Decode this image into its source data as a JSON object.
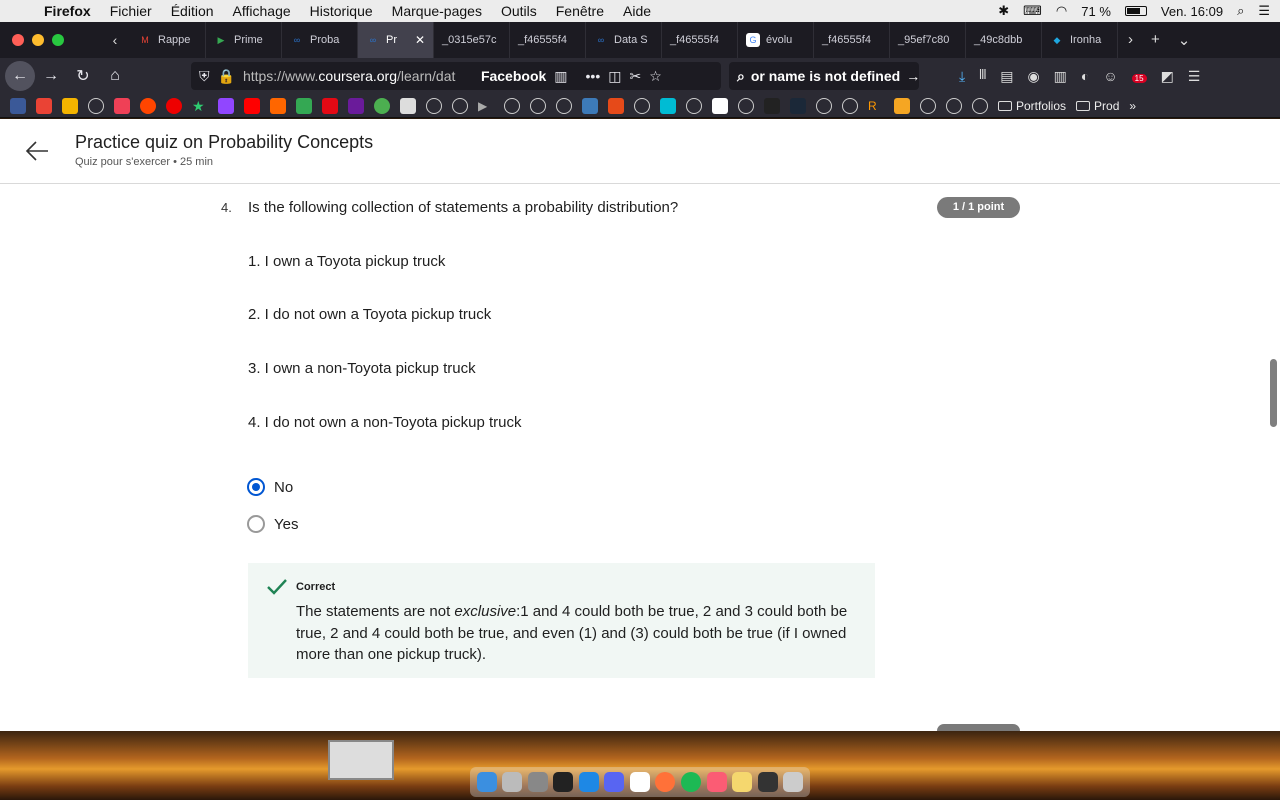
{
  "menubar": {
    "app": "Firefox",
    "items": [
      "Fichier",
      "Édition",
      "Affichage",
      "Historique",
      "Marque-pages",
      "Outils",
      "Fenêtre",
      "Aide"
    ],
    "battery": "71 %",
    "clock": "Ven. 16:09"
  },
  "tabs": [
    {
      "label": "Rappe",
      "color": "#ea4335",
      "glyph": "M"
    },
    {
      "label": "Prime",
      "color": "#36a852",
      "glyph": "▶"
    },
    {
      "label": "Proba",
      "color": "#2a73cc",
      "glyph": "∞"
    },
    {
      "label": "Pr",
      "color": "#2a73cc",
      "glyph": "∞",
      "active": true
    },
    {
      "label": "_0315e57c",
      "color": "",
      "glyph": ""
    },
    {
      "label": "_f46555f4",
      "color": "",
      "glyph": ""
    },
    {
      "label": "Data S",
      "color": "#2a73cc",
      "glyph": "∞"
    },
    {
      "label": "_f46555f4",
      "color": "",
      "glyph": ""
    },
    {
      "label": "évolu",
      "color": "#ffffff",
      "glyph": "G"
    },
    {
      "label": "_f46555f4",
      "color": "",
      "glyph": ""
    },
    {
      "label": "_95ef7c80",
      "color": "",
      "glyph": ""
    },
    {
      "label": "_49c8dbb",
      "color": "",
      "glyph": ""
    },
    {
      "label": "Ironha",
      "color": "#1ea7e0",
      "glyph": "◆"
    }
  ],
  "nav": {
    "url_prefix": "https://www.",
    "url_domain": "coursera.org",
    "url_path": "/learn/dat",
    "page_action": "Facebook",
    "search_text": "or name is not defined"
  },
  "bookmarks": {
    "folders": [
      "Portfolios",
      "Prod"
    ]
  },
  "page": {
    "title": "Practice quiz on Probability Concepts",
    "subtitle": "Quiz pour s'exercer • 25  min",
    "question": {
      "number": "4.",
      "text": "Is the following collection of statements a probability distribution?",
      "points": "1 / 1 point",
      "statements": [
        "1. I own a Toyota pickup truck",
        "2. I do not own a Toyota pickup truck",
        "3. I own a non-Toyota pickup truck",
        "4. I do not own a non-Toyota pickup truck"
      ],
      "options": [
        {
          "label": "No",
          "selected": true
        },
        {
          "label": "Yes",
          "selected": false
        }
      ],
      "feedback": {
        "title": "Correct",
        "text_before": "The statements are not ",
        "text_em": "exclusive",
        "text_after": ":1 and 4 could both be true, 2 and 3 could both be true, 2 and 4 could both be true, and even (1) and (3) could both be true (if I owned more than one pickup truck)."
      }
    }
  }
}
